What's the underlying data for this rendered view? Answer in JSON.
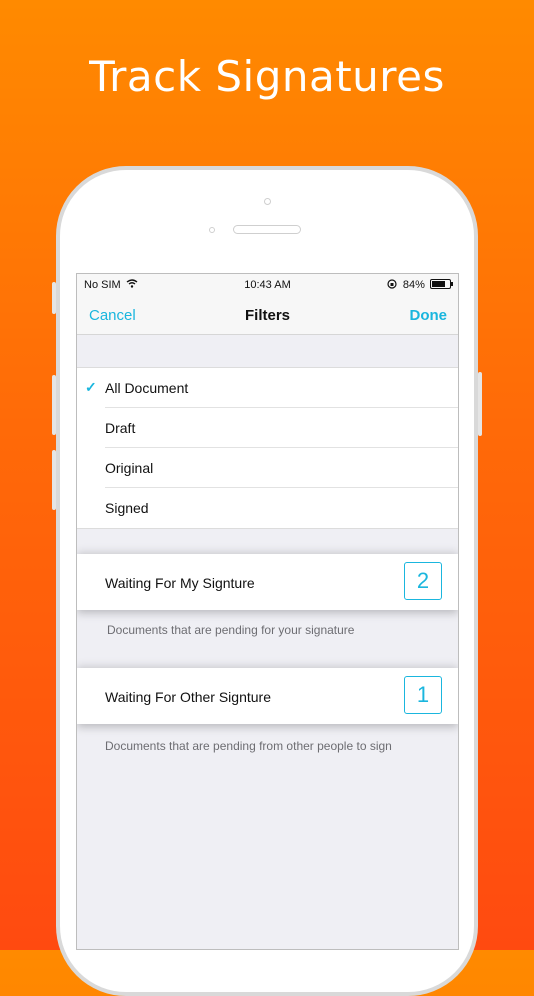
{
  "headline": "Track Signatures",
  "status_bar": {
    "carrier": "No SIM",
    "time": "10:43 AM",
    "battery": "84%",
    "battery_level": 0.84
  },
  "nav": {
    "cancel": "Cancel",
    "title": "Filters",
    "done": "Done"
  },
  "filters": [
    {
      "label": "All Document",
      "selected": true
    },
    {
      "label": "Draft",
      "selected": false
    },
    {
      "label": "Original",
      "selected": false
    },
    {
      "label": "Signed",
      "selected": false
    }
  ],
  "sections": [
    {
      "label": "Waiting For My Signture",
      "count": "2",
      "footer": "Documents that are pending for your signature"
    },
    {
      "label": "Waiting For Other Signture",
      "count": "1",
      "footer": "Documents that are pending from other people to sign"
    }
  ],
  "colors": {
    "accent": "#1ab6de",
    "background_top": "#ff8a00",
    "background_bottom": "#ff4a10"
  }
}
